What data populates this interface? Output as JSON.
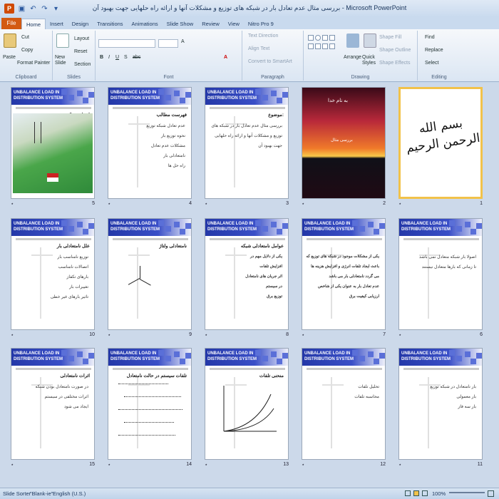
{
  "window": {
    "title": "بررسی مثال عدم تعادل بار در شبکه های توزیع و مشکلات آنها و ارائه راه حلهایی جهت بهبود آن - Microsoft PowerPoint"
  },
  "tabs": {
    "file": "File",
    "items": [
      "Home",
      "Insert",
      "Design",
      "Transitions",
      "Animations",
      "Slide Show",
      "Review",
      "View",
      "Nitro Pro 9"
    ]
  },
  "ribbon": {
    "clipboard": {
      "label": "Clipboard",
      "paste": "Paste",
      "cut": "Cut",
      "copy": "Copy",
      "format_painter": "Format Painter"
    },
    "slides": {
      "label": "Slides",
      "new_slide": "New Slide",
      "layout": "Layout",
      "reset": "Reset",
      "section": "Section"
    },
    "font": {
      "label": "Font"
    },
    "paragraph": {
      "label": "Paragraph",
      "text_direction": "Text Direction",
      "align_text": "Align Text",
      "smartart": "Convert to SmartArt"
    },
    "drawing": {
      "label": "Drawing",
      "arrange": "Arrange",
      "quick_styles": "Quick Styles",
      "shape_fill": "Shape Fill",
      "shape_outline": "Shape Outline",
      "shape_effects": "Shape Effects"
    },
    "editing": {
      "label": "Editing",
      "find": "Find",
      "replace": "Replace",
      "select": "Select"
    }
  },
  "slides": [
    {
      "n": "1",
      "type": "calligraphy",
      "text": "بسم الله الرحمن الرحیم"
    },
    {
      "n": "2",
      "type": "sunset",
      "title": "به نام خدا",
      "sub": "بررسی مثال"
    },
    {
      "n": "3",
      "type": "text",
      "header": "UNBALANCE LOAD IN\nDISTRIBUTION SYSTEM",
      "title": "موضوع:",
      "lines": [
        "بررسی مثال عدم تعادل بار در شبکه های",
        "توزیع و مشکلات آنها و ارائه راه حلهایی",
        "جهت بهبود آن"
      ]
    },
    {
      "n": "4",
      "type": "text",
      "header": "UNBALANCE LOAD IN\nDISTRIBUTION SYSTEM",
      "title": "فهرست مطالب",
      "lines": [
        "عدم تعادل شبکه توزیع",
        "نحوه توزیع بار",
        "مشکلات عدم تعادل",
        "نامتعادلی بار",
        "راه حل ها"
      ]
    },
    {
      "n": "5",
      "type": "diagram",
      "header": "UNBALANCE LOAD IN\nDISTRIBUTION SYSTEM",
      "title": "اجزای شبکه توزیع"
    },
    {
      "n": "6",
      "type": "text",
      "header": "UNBALANCE LOAD IN\nDISTRIBUTION SYSTEM",
      "title": "",
      "lines": [
        "اصولا بار شبکه متعادل نمی باشد",
        "تا زمانی که بارها متعادل نیستند"
      ]
    },
    {
      "n": "7",
      "type": "bold",
      "header": "UNBALANCE LOAD IN\nDISTRIBUTION SYSTEM",
      "lines": [
        "یکی از مشکلات موجود در شبکه های توزیع که",
        "باعث ایجاد تلفات انرژی و افزایش هزینه ها",
        "می گردد نامتعادلی بار می باشد",
        "عدم تعادل بار به عنوان یکی از شاخص",
        "ارزیابی کیفیت برق"
      ]
    },
    {
      "n": "8",
      "type": "bold",
      "header": "UNBALANCE LOAD IN\nDISTRIBUTION SYSTEM",
      "title": "عوامل نامتعادلی شبکه",
      "lines": [
        "یکی از دلایل مهم در",
        "افزایش تلفات",
        "اثر جریان های نامتعادل",
        "در سیستم",
        "توزیع برق"
      ]
    },
    {
      "n": "9",
      "type": "vectors",
      "header": "UNBALANCE LOAD IN\nDISTRIBUTION SYSTEM",
      "title": "نامتعادلی ولتاژ"
    },
    {
      "n": "10",
      "type": "text",
      "header": "UNBALANCE LOAD IN\nDISTRIBUTION SYSTEM",
      "title": "علل نامتعادلی بار",
      "lines": [
        "توزیع نامناسب بار",
        "اتصالات نامناسب",
        "بارهای تکفاز",
        "تغییرات بار",
        "تاثیر بارهای غیر خطی"
      ]
    },
    {
      "n": "11",
      "type": "text",
      "header": "UNBALANCE LOAD IN\nDISTRIBUTION SYSTEM",
      "title": "",
      "lines": [
        "بار نامتعادل در شبکه توزیع",
        "بار معمولی",
        "بار سه فاز"
      ]
    },
    {
      "n": "12",
      "type": "text",
      "header": "UNBALANCE LOAD IN\nDISTRIBUTION SYSTEM",
      "title": "",
      "lines": [
        "تحلیل تلفات",
        "محاسبه تلفات"
      ]
    },
    {
      "n": "13",
      "type": "curve",
      "header": "UNBALANCE LOAD IN\nDISTRIBUTION SYSTEM",
      "title": "منحنی تلفات"
    },
    {
      "n": "14",
      "type": "formula",
      "header": "UNBALANCE LOAD IN\nDISTRIBUTION SYSTEM",
      "title": "تلفات سیستم در حالت نامتعادل"
    },
    {
      "n": "15",
      "type": "text",
      "header": "UNBALANCE LOAD IN\nDISTRIBUTION SYSTEM",
      "title": "اثرات نامتعادلی",
      "lines": [
        "در صورت نامتعادل بودن شبکه",
        "اثرات مختلفی در سیستم",
        "ایجاد می شود"
      ]
    }
  ],
  "status": {
    "view": "Slide Sorter",
    "theme": "\"Blank-ie\"",
    "language": "English (U.S.)",
    "zoom": "100%"
  }
}
